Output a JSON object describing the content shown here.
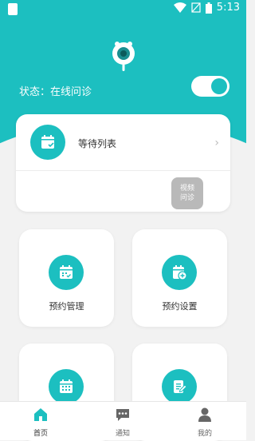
{
  "statusbar": {
    "time": "5:13"
  },
  "status": {
    "label": "状态：在线问诊",
    "toggle_on": true
  },
  "waiting": {
    "title": "等待列表",
    "video_line1": "视频",
    "video_line2": "问诊"
  },
  "tiles": [
    {
      "label": "预约管理"
    },
    {
      "label": "预约设置"
    },
    {
      "label": ""
    },
    {
      "label": ""
    }
  ],
  "nav": [
    {
      "label": "首页"
    },
    {
      "label": "通知"
    },
    {
      "label": "我的"
    }
  ],
  "colors": {
    "accent": "#1cbfc0",
    "background": "#f2f2f2",
    "video_button": "#b9b9b9"
  }
}
